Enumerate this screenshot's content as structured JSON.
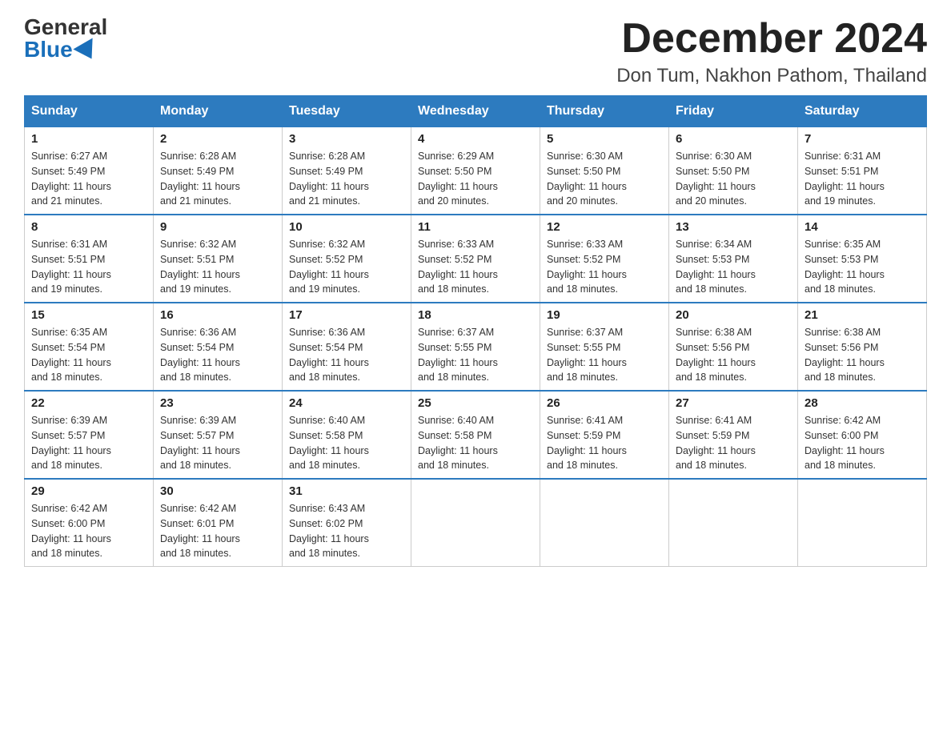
{
  "header": {
    "logo_general": "General",
    "logo_blue": "Blue",
    "month_title": "December 2024",
    "location": "Don Tum, Nakhon Pathom, Thailand"
  },
  "weekdays": [
    "Sunday",
    "Monday",
    "Tuesday",
    "Wednesday",
    "Thursday",
    "Friday",
    "Saturday"
  ],
  "weeks": [
    [
      {
        "day": "1",
        "sunrise": "6:27 AM",
        "sunset": "5:49 PM",
        "daylight": "11 hours and 21 minutes."
      },
      {
        "day": "2",
        "sunrise": "6:28 AM",
        "sunset": "5:49 PM",
        "daylight": "11 hours and 21 minutes."
      },
      {
        "day": "3",
        "sunrise": "6:28 AM",
        "sunset": "5:49 PM",
        "daylight": "11 hours and 21 minutes."
      },
      {
        "day": "4",
        "sunrise": "6:29 AM",
        "sunset": "5:50 PM",
        "daylight": "11 hours and 20 minutes."
      },
      {
        "day": "5",
        "sunrise": "6:30 AM",
        "sunset": "5:50 PM",
        "daylight": "11 hours and 20 minutes."
      },
      {
        "day": "6",
        "sunrise": "6:30 AM",
        "sunset": "5:50 PM",
        "daylight": "11 hours and 20 minutes."
      },
      {
        "day": "7",
        "sunrise": "6:31 AM",
        "sunset": "5:51 PM",
        "daylight": "11 hours and 19 minutes."
      }
    ],
    [
      {
        "day": "8",
        "sunrise": "6:31 AM",
        "sunset": "5:51 PM",
        "daylight": "11 hours and 19 minutes."
      },
      {
        "day": "9",
        "sunrise": "6:32 AM",
        "sunset": "5:51 PM",
        "daylight": "11 hours and 19 minutes."
      },
      {
        "day": "10",
        "sunrise": "6:32 AM",
        "sunset": "5:52 PM",
        "daylight": "11 hours and 19 minutes."
      },
      {
        "day": "11",
        "sunrise": "6:33 AM",
        "sunset": "5:52 PM",
        "daylight": "11 hours and 18 minutes."
      },
      {
        "day": "12",
        "sunrise": "6:33 AM",
        "sunset": "5:52 PM",
        "daylight": "11 hours and 18 minutes."
      },
      {
        "day": "13",
        "sunrise": "6:34 AM",
        "sunset": "5:53 PM",
        "daylight": "11 hours and 18 minutes."
      },
      {
        "day": "14",
        "sunrise": "6:35 AM",
        "sunset": "5:53 PM",
        "daylight": "11 hours and 18 minutes."
      }
    ],
    [
      {
        "day": "15",
        "sunrise": "6:35 AM",
        "sunset": "5:54 PM",
        "daylight": "11 hours and 18 minutes."
      },
      {
        "day": "16",
        "sunrise": "6:36 AM",
        "sunset": "5:54 PM",
        "daylight": "11 hours and 18 minutes."
      },
      {
        "day": "17",
        "sunrise": "6:36 AM",
        "sunset": "5:54 PM",
        "daylight": "11 hours and 18 minutes."
      },
      {
        "day": "18",
        "sunrise": "6:37 AM",
        "sunset": "5:55 PM",
        "daylight": "11 hours and 18 minutes."
      },
      {
        "day": "19",
        "sunrise": "6:37 AM",
        "sunset": "5:55 PM",
        "daylight": "11 hours and 18 minutes."
      },
      {
        "day": "20",
        "sunrise": "6:38 AM",
        "sunset": "5:56 PM",
        "daylight": "11 hours and 18 minutes."
      },
      {
        "day": "21",
        "sunrise": "6:38 AM",
        "sunset": "5:56 PM",
        "daylight": "11 hours and 18 minutes."
      }
    ],
    [
      {
        "day": "22",
        "sunrise": "6:39 AM",
        "sunset": "5:57 PM",
        "daylight": "11 hours and 18 minutes."
      },
      {
        "day": "23",
        "sunrise": "6:39 AM",
        "sunset": "5:57 PM",
        "daylight": "11 hours and 18 minutes."
      },
      {
        "day": "24",
        "sunrise": "6:40 AM",
        "sunset": "5:58 PM",
        "daylight": "11 hours and 18 minutes."
      },
      {
        "day": "25",
        "sunrise": "6:40 AM",
        "sunset": "5:58 PM",
        "daylight": "11 hours and 18 minutes."
      },
      {
        "day": "26",
        "sunrise": "6:41 AM",
        "sunset": "5:59 PM",
        "daylight": "11 hours and 18 minutes."
      },
      {
        "day": "27",
        "sunrise": "6:41 AM",
        "sunset": "5:59 PM",
        "daylight": "11 hours and 18 minutes."
      },
      {
        "day": "28",
        "sunrise": "6:42 AM",
        "sunset": "6:00 PM",
        "daylight": "11 hours and 18 minutes."
      }
    ],
    [
      {
        "day": "29",
        "sunrise": "6:42 AM",
        "sunset": "6:00 PM",
        "daylight": "11 hours and 18 minutes."
      },
      {
        "day": "30",
        "sunrise": "6:42 AM",
        "sunset": "6:01 PM",
        "daylight": "11 hours and 18 minutes."
      },
      {
        "day": "31",
        "sunrise": "6:43 AM",
        "sunset": "6:02 PM",
        "daylight": "11 hours and 18 minutes."
      },
      null,
      null,
      null,
      null
    ]
  ],
  "labels": {
    "sunrise": "Sunrise:",
    "sunset": "Sunset:",
    "daylight": "Daylight:"
  }
}
